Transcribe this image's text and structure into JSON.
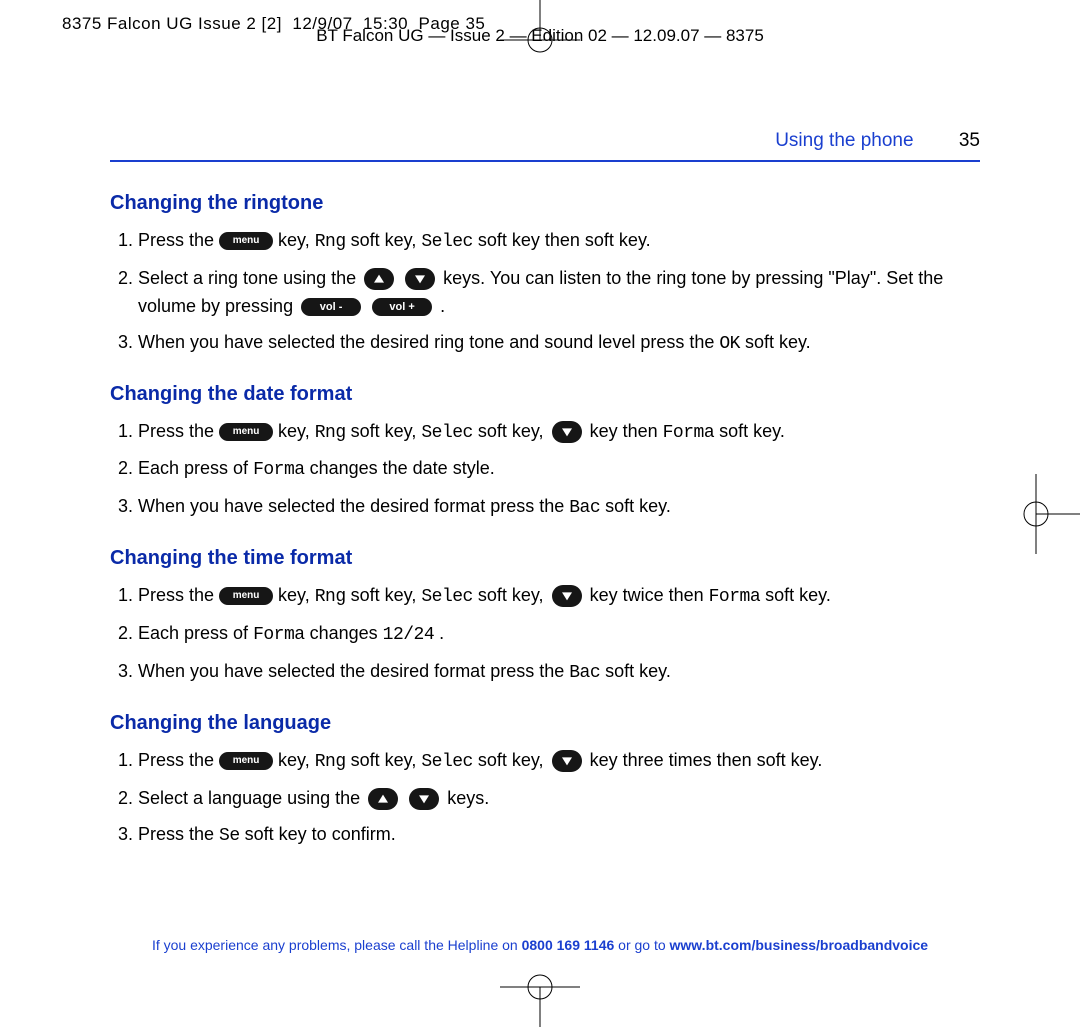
{
  "print_slug": "8375 Falcon UG Issue 2 [2]  12/9/07  15:30  Page 35",
  "header_center": "BT Falcon UG — Issue 2 — Edition 02 — 12.09.07 — 8375",
  "running_head": {
    "section": "Using the phone",
    "page": "35"
  },
  "icons": {
    "menu": "menu",
    "vol_minus": "vol -",
    "vol_plus": "vol +"
  },
  "sections": [
    {
      "heading": "Changing the ringtone",
      "items": [
        {
          "segments": [
            {
              "t": "text",
              "v": "Press the "
            },
            {
              "t": "menu"
            },
            {
              "t": "text",
              "v": "  key, "
            },
            {
              "t": "mono",
              "v": "Rng"
            },
            {
              "t": "text",
              "v": "  soft key, "
            },
            {
              "t": "mono",
              "v": "Selec"
            },
            {
              "t": "text",
              "v": "  soft key then      soft key."
            }
          ]
        },
        {
          "segments": [
            {
              "t": "text",
              "v": "Select a ring tone using the "
            },
            {
              "t": "tri-up"
            },
            {
              "t": "text",
              "v": "  "
            },
            {
              "t": "tri-down"
            },
            {
              "t": "text",
              "v": "   keys. You can listen to the ring tone by pressing \"Play\". Set the volume by pressing "
            },
            {
              "t": "vol-"
            },
            {
              "t": "text",
              "v": "  "
            },
            {
              "t": "vol+"
            },
            {
              "t": "text",
              "v": " ."
            }
          ]
        },
        {
          "segments": [
            {
              "t": "text",
              "v": "When you have selected the desired ring tone and sound level press the "
            },
            {
              "t": "mono",
              "v": "OK"
            },
            {
              "t": "text",
              "v": " soft key."
            }
          ]
        }
      ]
    },
    {
      "heading": "Changing the date format",
      "items": [
        {
          "segments": [
            {
              "t": "text",
              "v": "Press the "
            },
            {
              "t": "menu"
            },
            {
              "t": "text",
              "v": "  key, "
            },
            {
              "t": "mono",
              "v": "Rng"
            },
            {
              "t": "text",
              "v": "  soft key, "
            },
            {
              "t": "mono",
              "v": "Selec"
            },
            {
              "t": "text",
              "v": "  soft key, "
            },
            {
              "t": "tri-down"
            },
            {
              "t": "text",
              "v": "  key then "
            },
            {
              "t": "mono",
              "v": "Forma"
            },
            {
              "t": "text",
              "v": "  soft key."
            }
          ]
        },
        {
          "segments": [
            {
              "t": "text",
              "v": "Each press of "
            },
            {
              "t": "mono",
              "v": "Forma"
            },
            {
              "t": "text",
              "v": "  changes the date style."
            }
          ]
        },
        {
          "segments": [
            {
              "t": "text",
              "v": "When you have selected the desired format press the "
            },
            {
              "t": "mono",
              "v": "Bac"
            },
            {
              "t": "text",
              "v": " soft key."
            }
          ]
        }
      ]
    },
    {
      "heading": "Changing the time format",
      "items": [
        {
          "segments": [
            {
              "t": "text",
              "v": "Press the "
            },
            {
              "t": "menu"
            },
            {
              "t": "text",
              "v": "  key, "
            },
            {
              "t": "mono",
              "v": "Rng"
            },
            {
              "t": "text",
              "v": "  soft key, "
            },
            {
              "t": "mono",
              "v": "Selec"
            },
            {
              "t": "text",
              "v": "  soft key, "
            },
            {
              "t": "tri-down"
            },
            {
              "t": "text",
              "v": "  key twice then "
            },
            {
              "t": "mono",
              "v": "Forma"
            },
            {
              "t": "text",
              "v": "  soft key."
            }
          ]
        },
        {
          "segments": [
            {
              "t": "text",
              "v": "Each press of "
            },
            {
              "t": "mono",
              "v": "Forma"
            },
            {
              "t": "text",
              "v": "  changes "
            },
            {
              "t": "mono",
              "v": "12/24"
            },
            {
              "t": "text",
              "v": " ."
            }
          ]
        },
        {
          "segments": [
            {
              "t": "text",
              "v": "When you have selected the desired format press the "
            },
            {
              "t": "mono",
              "v": "Bac"
            },
            {
              "t": "text",
              "v": "  soft key."
            }
          ]
        }
      ]
    },
    {
      "heading": "Changing the language",
      "items": [
        {
          "segments": [
            {
              "t": "text",
              "v": "Press the "
            },
            {
              "t": "menu"
            },
            {
              "t": "text",
              "v": "  key, "
            },
            {
              "t": "mono",
              "v": "Rng"
            },
            {
              "t": "text",
              "v": "  soft key, "
            },
            {
              "t": "mono",
              "v": "Selec"
            },
            {
              "t": "text",
              "v": "  soft key, "
            },
            {
              "t": "tri-down"
            },
            {
              "t": "text",
              "v": "  key three times then    soft key."
            }
          ]
        },
        {
          "segments": [
            {
              "t": "text",
              "v": "Select a language using the "
            },
            {
              "t": "tri-up"
            },
            {
              "t": "text",
              "v": "  "
            },
            {
              "t": "tri-down"
            },
            {
              "t": "text",
              "v": "   keys."
            }
          ]
        },
        {
          "segments": [
            {
              "t": "text",
              "v": "Press the "
            },
            {
              "t": "mono",
              "v": "Se"
            },
            {
              "t": "text",
              "v": "  soft key to confirm."
            }
          ]
        }
      ]
    }
  ],
  "footer": {
    "prefix": "If you experience any problems, please call the Helpline on ",
    "phone": "0800 169 1146",
    "mid": " or go to ",
    "url": "www.bt.com/business/broadbandvoice"
  }
}
